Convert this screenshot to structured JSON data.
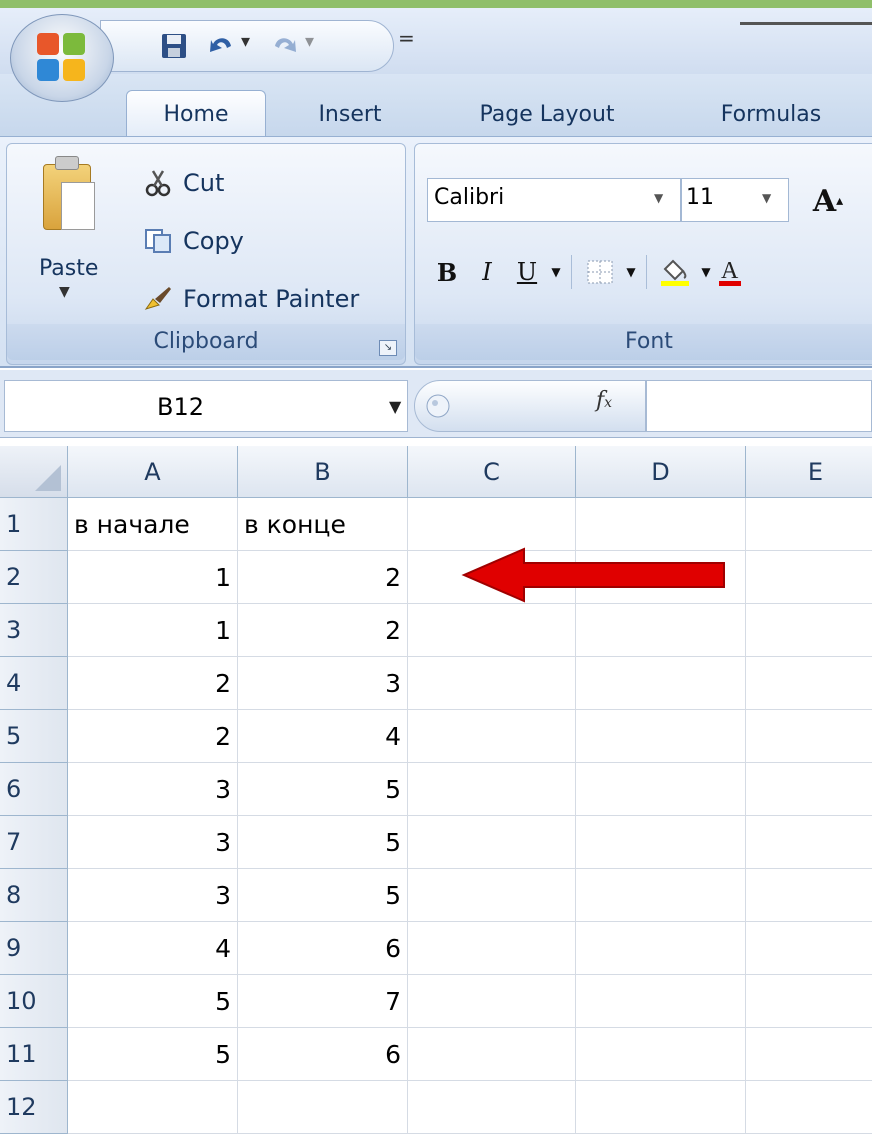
{
  "window": {
    "qat": {
      "save_icon": "save-icon",
      "undo_icon": "undo-icon",
      "redo_icon": "redo-icon",
      "more": "="
    }
  },
  "tabs": [
    {
      "label": "Home",
      "active": true
    },
    {
      "label": "Insert",
      "active": false
    },
    {
      "label": "Page Layout",
      "active": false
    },
    {
      "label": "Formulas",
      "active": false
    }
  ],
  "ribbon": {
    "clipboard": {
      "paste": "Paste",
      "cut": "Cut",
      "copy": "Copy",
      "format_painter": "Format Painter",
      "label": "Clipboard"
    },
    "font": {
      "name": "Calibri",
      "size": "11",
      "grow": "A",
      "bold": "B",
      "italic": "I",
      "underline": "U",
      "label": "Font"
    }
  },
  "formula_bar": {
    "name_box": "B12",
    "fx": "fx",
    "formula": ""
  },
  "sheet": {
    "columns": [
      "A",
      "B",
      "C",
      "D",
      "E"
    ],
    "rows": [
      {
        "num": "1",
        "a": "в начале",
        "b": "в конце"
      },
      {
        "num": "2",
        "a": "1",
        "b": "2"
      },
      {
        "num": "3",
        "a": "1",
        "b": "2"
      },
      {
        "num": "4",
        "a": "2",
        "b": "3"
      },
      {
        "num": "5",
        "a": "2",
        "b": "4"
      },
      {
        "num": "6",
        "a": "3",
        "b": "5"
      },
      {
        "num": "7",
        "a": "3",
        "b": "5"
      },
      {
        "num": "8",
        "a": "3",
        "b": "5"
      },
      {
        "num": "9",
        "a": "4",
        "b": "6"
      },
      {
        "num": "10",
        "a": "5",
        "b": "7"
      },
      {
        "num": "11",
        "a": "5",
        "b": "6"
      },
      {
        "num": "12",
        "a": "",
        "b": ""
      }
    ]
  },
  "colors": {
    "accent_arrow": "#e00000",
    "header_text": "#1f3a5f",
    "gridline": "#d5dbe4"
  }
}
